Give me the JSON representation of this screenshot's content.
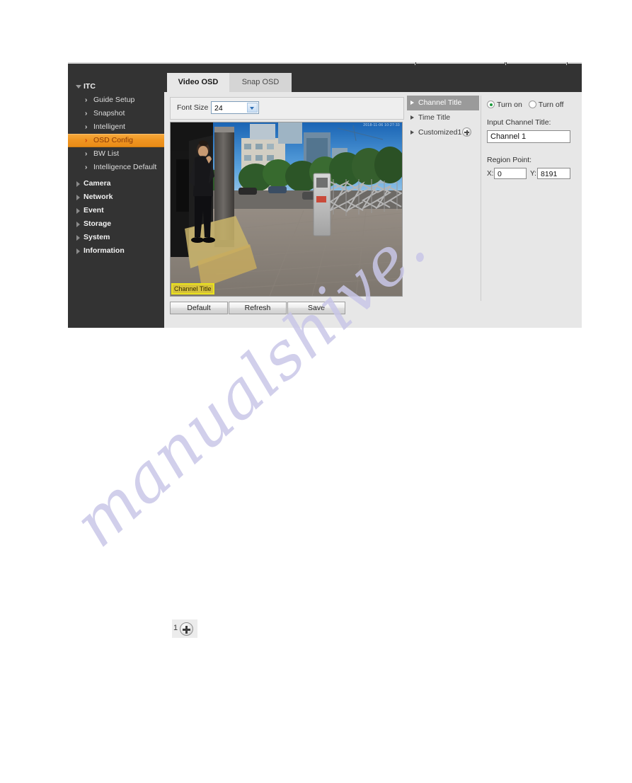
{
  "sidebar": {
    "items": [
      {
        "label": "ITC",
        "type": "root",
        "expanded": true
      },
      {
        "label": "Guide Setup",
        "type": "sub",
        "active": false
      },
      {
        "label": "Snapshot",
        "type": "sub",
        "active": false
      },
      {
        "label": "Intelligent",
        "type": "sub",
        "active": false
      },
      {
        "label": "OSD Config",
        "type": "sub",
        "active": true
      },
      {
        "label": "BW List",
        "type": "sub",
        "active": false
      },
      {
        "label": "Intelligence Default",
        "type": "sub",
        "active": false
      },
      {
        "label": "Camera",
        "type": "root",
        "expanded": false
      },
      {
        "label": "Network",
        "type": "root",
        "expanded": false
      },
      {
        "label": "Event",
        "type": "root",
        "expanded": false
      },
      {
        "label": "Storage",
        "type": "root",
        "expanded": false
      },
      {
        "label": "System",
        "type": "root",
        "expanded": false
      },
      {
        "label": "Information",
        "type": "root",
        "expanded": false
      }
    ]
  },
  "tabs": [
    {
      "label": "Video OSD",
      "active": true
    },
    {
      "label": "Snap OSD",
      "active": false
    }
  ],
  "toolbar": {
    "font_size_label": "Font Size",
    "font_size_value": "24"
  },
  "video": {
    "osd_overlay_text": "Channel Title",
    "timestamp_overlay": "2018-11-06 10:27:33"
  },
  "buttons": {
    "default_label": "Default",
    "refresh_label": "Refresh",
    "save_label": "Save"
  },
  "osd_list": [
    {
      "label": "Channel Title",
      "selected": true,
      "has_add": false
    },
    {
      "label": "Time Title",
      "selected": false,
      "has_add": false
    },
    {
      "label": "Customized1",
      "selected": false,
      "has_add": true
    }
  ],
  "properties": {
    "turn_on_label": "Turn on",
    "turn_off_label": "Turn off",
    "enabled": true,
    "input_channel_title_label": "Input Channel Title:",
    "channel_title_value": "Channel 1",
    "region_point_label": "Region Point:",
    "x_label": "X:",
    "x_value": "0",
    "y_label": "Y:",
    "y_value": "8191"
  },
  "add_widget": {
    "number": "1",
    "icon": "plus-circle-icon"
  },
  "watermark": {
    "text": "manualshive."
  },
  "colors": {
    "sidebar_bg": "#333333",
    "accent_orange": "#ef9420",
    "panel_bg": "#e7e7e7",
    "selected_row": "#9a9a9a",
    "osd_yellow": "#e9e21c",
    "radio_green": "#1f9a3e",
    "watermark": "#c9c7e8"
  }
}
